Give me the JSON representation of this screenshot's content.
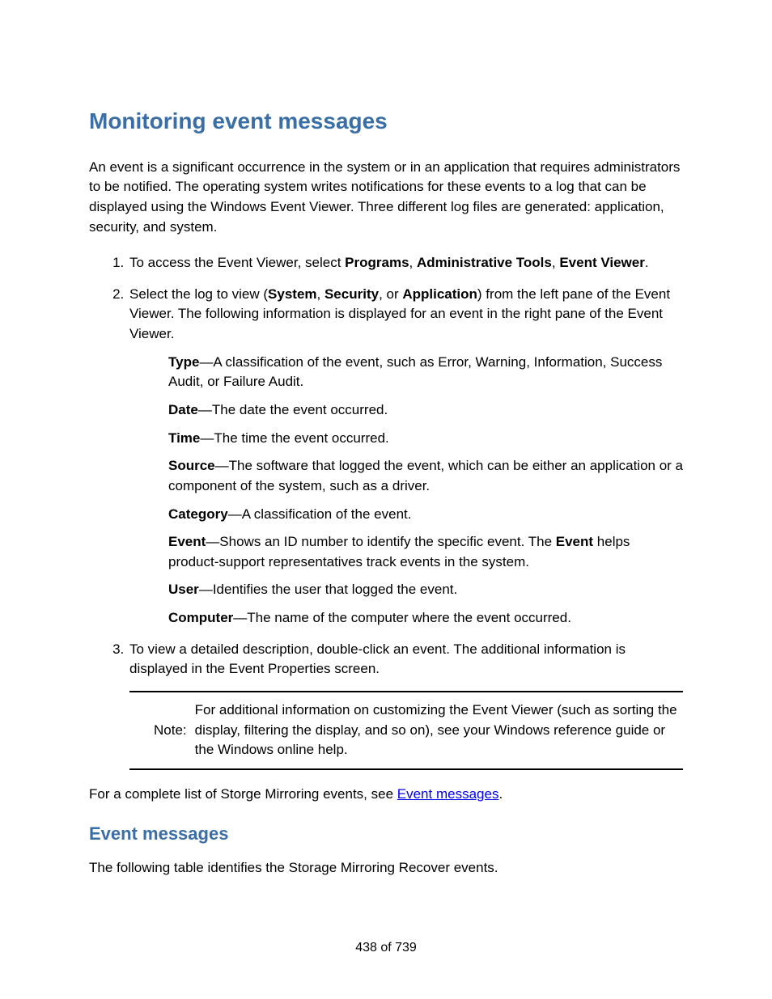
{
  "heading1": "Monitoring event messages",
  "intro": "An event is a significant occurrence in the system or in an application that requires administrators to be notified. The operating system writes notifications for these events to a log that can be displayed using the Windows Event Viewer. Three different log files are generated: application, security, and system.",
  "step1": {
    "pre": "To access the Event Viewer, select ",
    "b1": "Programs",
    "s1": ", ",
    "b2": "Administrative Tools",
    "s2": ", ",
    "b3": "Event Viewer",
    "post": "."
  },
  "step2": {
    "pre": "Select the log to view (",
    "b1": "System",
    "s1": ", ",
    "b2": "Security",
    "s2": ", or ",
    "b3": "Application",
    "post": ") from the left pane of the Event Viewer. The following information is displayed for an event in the right pane of the Event Viewer."
  },
  "defs": {
    "type": {
      "label": "Type",
      "text": "—A classification of the event, such as Error, Warning, Information, Success Audit, or Failure Audit."
    },
    "date": {
      "label": "Date",
      "text": "—The date the event occurred."
    },
    "time": {
      "label": "Time",
      "text": "—The time the event occurred."
    },
    "source": {
      "label": "Source",
      "text": "—The software that logged the event, which can be either an application or a component of the system, such as a driver."
    },
    "category": {
      "label": "Category",
      "text": "—A classification of the event."
    },
    "event": {
      "label": "Event",
      "pre": "—Shows an ID number to identify the specific event. The ",
      "b": "Event",
      "post": " helps product-support representatives track events in the system."
    },
    "user": {
      "label": "User",
      "text": "—Identifies the user that logged the event."
    },
    "computer": {
      "label": "Computer",
      "text": "—The name of the computer where the event occurred."
    }
  },
  "step3": "To view a detailed description, double-click an event. The additional information is displayed in the Event Properties screen.",
  "note": {
    "label": "Note:",
    "text": "For additional information on customizing the Event Viewer (such as sorting the display, filtering the display, and so on), see your Windows reference guide or the Windows online help."
  },
  "closing": {
    "pre": "For a complete list of Storge Mirroring events, see ",
    "link": "Event messages",
    "post": "."
  },
  "heading2": "Event messages",
  "sub_intro": "The following table identifies the Storage Mirroring Recover events.",
  "page_num": "438 of 739"
}
